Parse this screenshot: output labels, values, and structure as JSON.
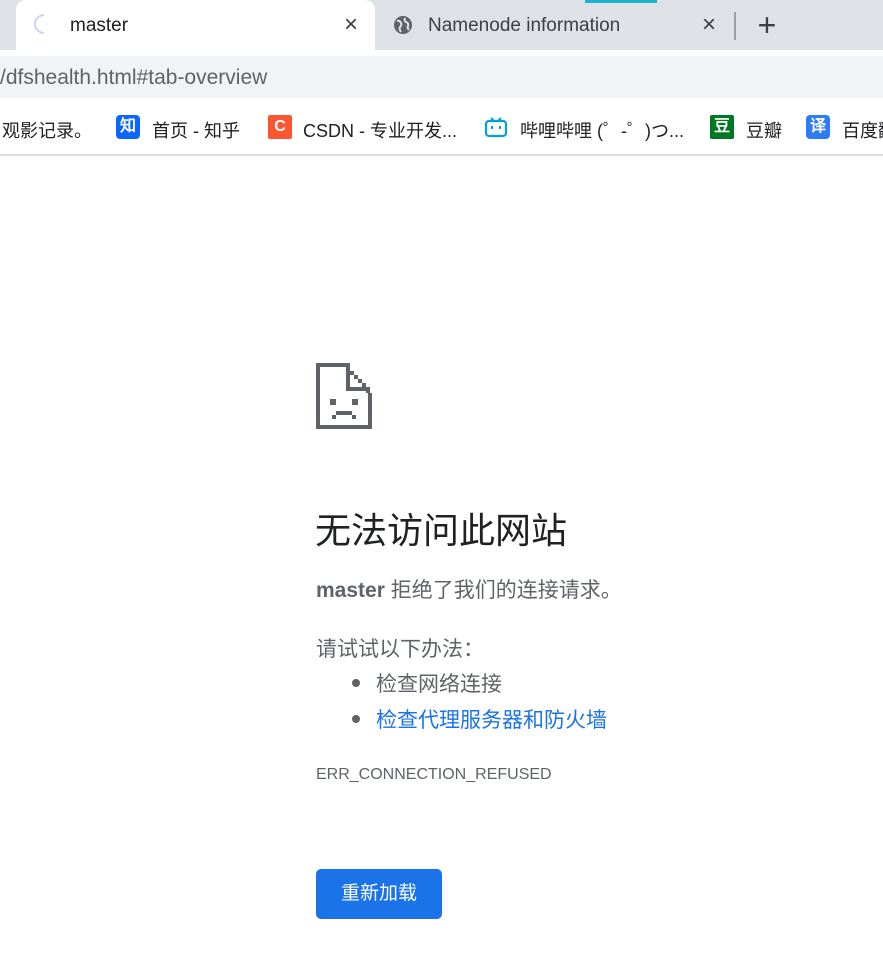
{
  "browser": {
    "tabs": [
      {
        "title": "master",
        "loading": true
      },
      {
        "title": "Namenode information",
        "loading": false
      }
    ],
    "close_glyph": "×",
    "new_tab_glyph": "+",
    "url": "/dfshealth.html#tab-overview",
    "bookmarks": [
      {
        "label": "观影记录。",
        "icon": null
      },
      {
        "label": "首页 - 知乎",
        "icon": "知",
        "icon_color": "#0a66ff"
      },
      {
        "label": "CSDN - 专业开发...",
        "icon": "C",
        "icon_color": "#fc5531"
      },
      {
        "label": "哔哩哔哩 (゜-゜)つ...",
        "icon": "bilibili-icon",
        "icon_color": "#00a1d6"
      },
      {
        "label": "豆瓣",
        "icon": "豆",
        "icon_color": "#007722"
      },
      {
        "label": "百度翻",
        "icon": "译",
        "icon_color": "#2d7cf6"
      }
    ]
  },
  "error_page": {
    "title": "无法访问此网站",
    "host": "master",
    "message_rest": " 拒绝了我们的连接请求。",
    "try_heading": "请试试以下办法：",
    "suggestions": [
      {
        "text": "检查网络连接",
        "link": false
      },
      {
        "text": "检查代理服务器和防火墙",
        "link": true
      }
    ],
    "error_code": "ERR_CONNECTION_REFUSED",
    "reload_label": "重新加载"
  },
  "colors": {
    "accent": "#1a73e8",
    "link": "#1a73e8",
    "muted_text": "#5f6368"
  }
}
